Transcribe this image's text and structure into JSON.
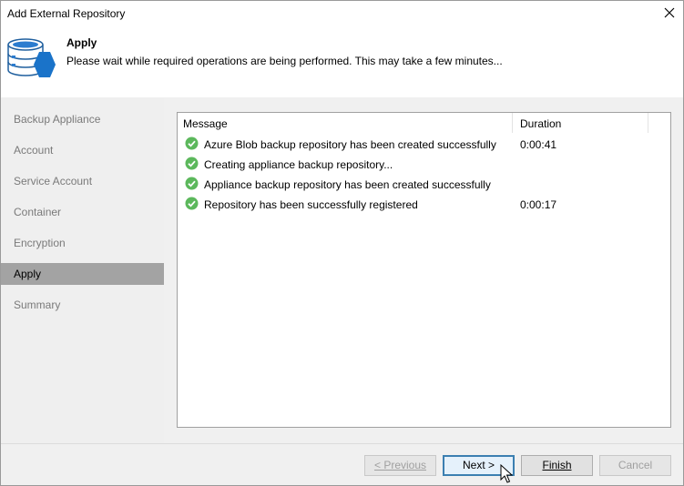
{
  "window": {
    "title": "Add External Repository"
  },
  "header": {
    "title": "Apply",
    "subtitle": "Please wait while required operations are being performed. This may take a few minutes...",
    "icon": "repository-database-icon"
  },
  "sidebar": {
    "steps": [
      {
        "label": "Backup Appliance"
      },
      {
        "label": "Account"
      },
      {
        "label": "Service Account"
      },
      {
        "label": "Container"
      },
      {
        "label": "Encryption"
      },
      {
        "label": "Apply"
      },
      {
        "label": "Summary"
      }
    ],
    "active_step": "Apply"
  },
  "log": {
    "columns": {
      "message": "Message",
      "duration": "Duration"
    },
    "rows": [
      {
        "message": "Azure Blob backup repository has been created successfully",
        "duration": "0:00:41",
        "status": "success"
      },
      {
        "message": "Creating appliance backup repository...",
        "duration": "",
        "status": "success"
      },
      {
        "message": "Appliance backup repository has been created successfully",
        "duration": "",
        "status": "success"
      },
      {
        "message": "Repository has been successfully registered",
        "duration": "0:00:17",
        "status": "success"
      }
    ]
  },
  "buttons": {
    "previous": "< Previous",
    "next": "Next >",
    "finish": "Finish",
    "cancel": "Cancel"
  },
  "colors": {
    "success": "#5cb85c",
    "active_step_bg": "#a3a3a3",
    "icon_blue": "#1a73c9"
  }
}
